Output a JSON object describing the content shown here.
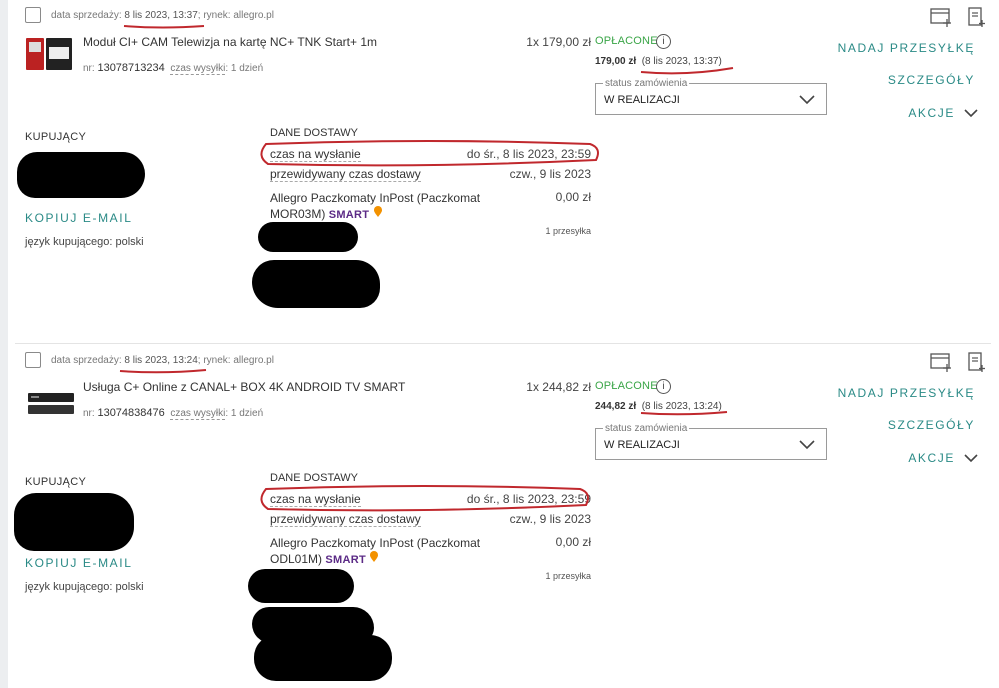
{
  "orders": [
    {
      "sale_date_label": "data sprzedaży:",
      "sale_date": "8 lis 2023, 13:37",
      "market_label": "rynek:",
      "market": "allegro.pl",
      "product_name": "Moduł CI+ CAM Telewizja na kartę NC+ TNK Start+ 1m",
      "nr_label": "nr:",
      "number": "13078713234",
      "ship_time_label": "czas wysyłki",
      "ship_time": ": 1 dzień",
      "qty_price": "1x 179,00 zł",
      "payment_status": "OPŁACONE",
      "info_icon": "info-icon",
      "amount": "179,00 zł",
      "amount_date": "(8 lis 2023, 13:37)",
      "status_label": "status zamówienia",
      "status_value": "W REALIZACJI",
      "action_send": "NADAJ PRZESYŁKĘ",
      "action_details": "SZCZEGÓŁY",
      "action_more": "AKCJE",
      "buyer_header": "KUPUJĄCY",
      "copy_email": "KOPIUJ E-MAIL",
      "buyer_lang": "język kupującego: polski",
      "delivery_header": "DANE DOSTAWY",
      "send_time_label": "czas na wysłanie",
      "send_time_value": "do śr., 8 lis 2023, 23:59",
      "est_delivery_label": "przewidywany czas dostawy",
      "est_delivery_value": "czw., 9 lis 2023",
      "method_text": "Allegro Paczkomaty InPost (Paczkomat MOR03M)",
      "smart": "SMART",
      "method_price": "0,00 zł",
      "packages": "1 przesyłka"
    },
    {
      "sale_date_label": "data sprzedaży:",
      "sale_date": "8 lis 2023, 13:24",
      "market_label": "rynek:",
      "market": "allegro.pl",
      "product_name": "Usługa C+ Online z CANAL+ BOX 4K ANDROID TV SMART",
      "nr_label": "nr:",
      "number": "13074838476",
      "ship_time_label": "czas wysyłki",
      "ship_time": ": 1 dzień",
      "qty_price": "1x 244,82 zł",
      "payment_status": "OPŁACONE",
      "info_icon": "info-icon",
      "amount": "244,82 zł",
      "amount_date": "(8 lis 2023, 13:24)",
      "status_label": "status zamówienia",
      "status_value": "W REALIZACJI",
      "action_send": "NADAJ PRZESYŁKĘ",
      "action_details": "SZCZEGÓŁY",
      "action_more": "AKCJE",
      "buyer_header": "KUPUJĄCY",
      "copy_email": "KOPIUJ E-MAIL",
      "buyer_lang": "język kupującego: polski",
      "delivery_header": "DANE DOSTAWY",
      "send_time_label": "czas na wysłanie",
      "send_time_value": "do śr., 8 lis 2023, 23:59",
      "est_delivery_label": "przewidywany czas dostawy",
      "est_delivery_value": "czw., 9 lis 2023",
      "method_text": "Allegro Paczkomaty InPost (Paczkomat ODL01M)",
      "smart": "SMART",
      "method_price": "0,00 zł",
      "packages": "1 przesyłka"
    }
  ],
  "colors": {
    "accent": "#2a8a86",
    "paid": "#3aa547",
    "smart": "#5b2a86",
    "smart_icon": "#f39200",
    "annotation": "#c0282d"
  }
}
